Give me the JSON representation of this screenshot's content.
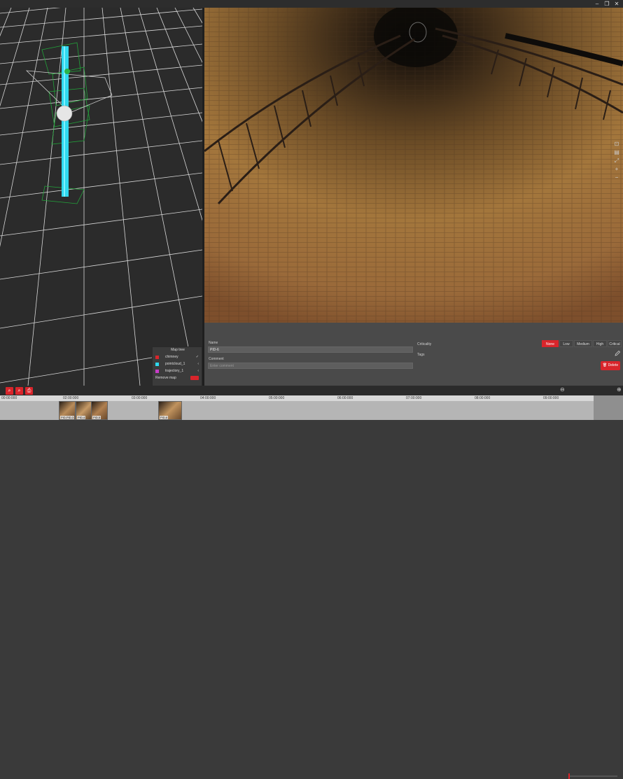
{
  "window": {
    "minimize": "–",
    "restore": "❐",
    "close": "✕"
  },
  "layers": {
    "title": "Map tree",
    "items": [
      {
        "label": "chimney",
        "color": "#d9252b"
      },
      {
        "label": "pointcloud_1",
        "color": "#2fd8ef"
      },
      {
        "label": "trajectory_1",
        "color": "#c83cc8"
      }
    ],
    "remove_label": "Remove map"
  },
  "detail": {
    "name_label": "Name",
    "name_value": "PID-6",
    "comment_label": "Comment",
    "comment_placeholder": "Enter comment",
    "criticality_label": "Criticality",
    "tags_label": "Tags",
    "criticality_options": [
      "None",
      "Low",
      "Medium",
      "High",
      "Critical"
    ],
    "criticality_selected": "None",
    "delete_label": "Delete"
  },
  "timeline": {
    "ticks": [
      "00:00:000",
      "02:00:000",
      "03:00:000",
      "04:00:000",
      "05:00:000",
      "06:00:000",
      "07:00:000",
      "08:00:000",
      "09:00:000"
    ],
    "thumbnails": [
      "PID-PID-3",
      "PID-4",
      "PID-5",
      "PID-6"
    ]
  },
  "colors": {
    "accent": "#d9252b",
    "pointcloud": "#2fd8ef"
  }
}
